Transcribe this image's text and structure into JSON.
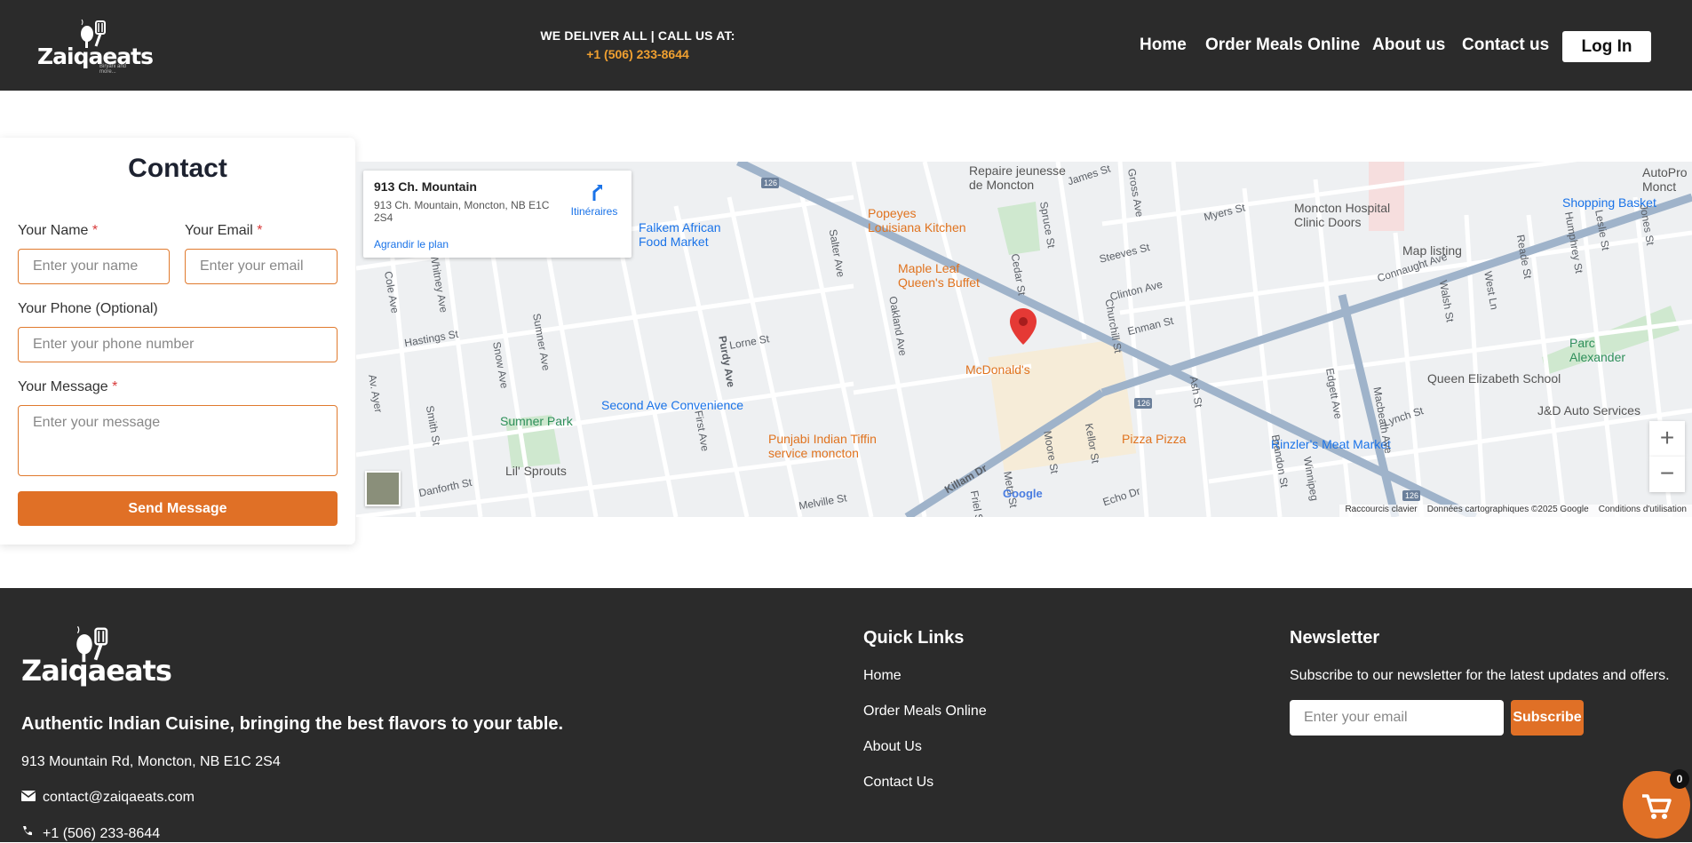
{
  "header": {
    "logo_text": "Zaiqaeats",
    "logo_tagline": "Biryani and more...",
    "deliver_text": "WE DELIVER ALL | CALL US AT:",
    "phone": "+1 (506) 233-8644",
    "nav": [
      "Home",
      "Order Meals Online",
      "About us",
      "Contact us"
    ],
    "login_label": "Log In"
  },
  "contact": {
    "title": "Contact",
    "name_label": "Your Name",
    "name_placeholder": "Enter your name",
    "email_label": "Your Email",
    "email_placeholder": "Enter your email",
    "phone_label": "Your Phone (Optional)",
    "phone_placeholder": "Enter your phone number",
    "message_label": "Your Message",
    "message_placeholder": "Enter your message",
    "required_mark": "*",
    "send_label": "Send Message"
  },
  "map": {
    "place_title": "913 Ch. Mountain",
    "place_address": "913 Ch. Mountain, Moncton, NB E1C 2S4",
    "directions_label": "Itinéraires",
    "enlarge_label": "Agrandir le plan",
    "zoom_in": "+",
    "zoom_out": "−",
    "attrib_shortcuts": "Raccourcis clavier",
    "attrib_data": "Données cartographiques ©2025 Google",
    "attrib_terms": "Conditions d'utilisation",
    "google_mark": "Google",
    "route_number": "126",
    "pois": {
      "repaire": "Repaire jeunesse\nde Moncton",
      "popeyes": "Popeyes\nLouisiana Kitchen",
      "falkem": "Falkem African\nFood Market",
      "maple": "Maple Leaf\nQueen's Buffet",
      "mcdonalds": "McDonald's",
      "hospital": "Moncton Hospital\nClinic Doors",
      "shopping": "Shopping Basket",
      "autopro": "AutoPro\nMonct",
      "maplisting": "Map listing",
      "parc": "Parc\nAlexander",
      "queen_eliz": "Queen Elizabeth School",
      "jd": "J&D Auto Services",
      "rinzler": "Rinzler's Meat Market",
      "pizza": "Pizza Pizza",
      "punjabi": "Punjabi Indian Tiffin\nservice moncton",
      "second_ave": "Second Ave Convenience",
      "sumner": "Sumner Park",
      "lil": "Lil' Sprouts"
    },
    "streets": [
      "Hastings St",
      "Lorne St",
      "Cole Ave",
      "Whitney Ave",
      "Sumner Ave",
      "Snow Ave",
      "Purdy Ave",
      "Salter Ave",
      "Oakland Ave",
      "Cedar St",
      "Spruce St",
      "Churchill St",
      "Enman St",
      "Clinton Ave",
      "Steeves St",
      "Gross Ave",
      "James St",
      "Myers St",
      "Connaught Ave",
      "Walsh St",
      "West Ln",
      "Reade St",
      "Humphrey St",
      "Leslie St",
      "Jones St",
      "Lynch St",
      "Ash St",
      "Edgett Ave",
      "Macbeath Ave",
      "Brandon St",
      "Kellor St",
      "Moore St",
      "Killam Dr",
      "Echo Dr",
      "Melville St",
      "First Ave",
      "Danforth St",
      "Smith St",
      "Av. Ayer",
      "Meta St",
      "Friel St",
      "Winnipeg"
    ]
  },
  "footer": {
    "logo_text": "Zaiqaeats",
    "tagline": "Authentic Indian Cuisine, bringing the best flavors to your table.",
    "address": "913 Mountain Rd, Moncton, NB E1C 2S4",
    "email": "contact@zaiqaeats.com",
    "phone": "+1 (506) 233-8644",
    "quick_links_title": "Quick Links",
    "quick_links": [
      "Home",
      "Order Meals Online",
      "About Us",
      "Contact Us"
    ],
    "newsletter_title": "Newsletter",
    "newsletter_text": "Subscribe to our newsletter for the latest updates and offers.",
    "newsletter_placeholder": "Enter your email",
    "subscribe_label": "Subscribe"
  },
  "cart": {
    "count": "0"
  },
  "colors": {
    "accent": "#e07026",
    "dark": "#2b2b2b",
    "phone": "#f0a030"
  }
}
